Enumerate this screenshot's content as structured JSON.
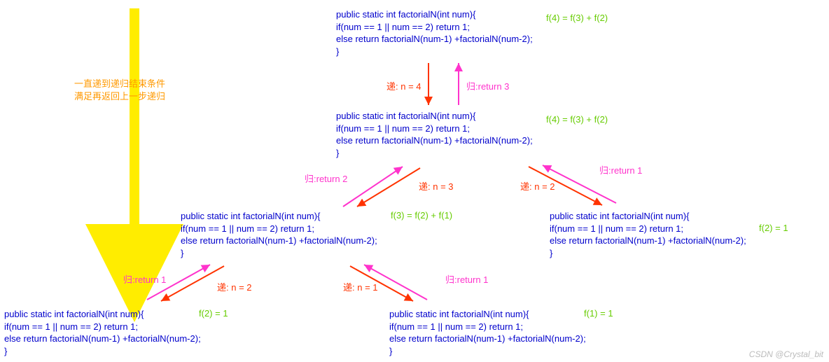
{
  "code": {
    "signature": "public static int factorialN(int num){",
    "line_if": "    if(num == 1 || num == 2) return 1;",
    "line_else": "    else return factorialN(num-1) +factorialN(num-2);",
    "close": "}"
  },
  "notes": {
    "n4": "f(4) = f(3) + f(2)",
    "n4b": "f(4) = f(3) + f(2)",
    "n3": "f(3) = f(2) + f(1)",
    "n2_eq": "f(2) =  1",
    "n2_eq_b": "f(2) =  1",
    "n1_eq": "f(1) = 1"
  },
  "comments": {
    "explain1": "一直递到递归结束条件",
    "explain2": "满足再返回上一步递归"
  },
  "arrows": {
    "down_n4": "递: n = 4",
    "down_n3": "递: n = 3",
    "down_n2": "递: n = 2",
    "down_n2b": "递: n = 2",
    "down_n1": "递: n = 1",
    "up_ret3": "归:return  3",
    "up_ret2": "归:return  2",
    "up_ret1a": "归:return 1",
    "up_ret1b": "归:return 1",
    "up_ret1c": "归:return  1"
  },
  "watermark": "CSDN @Crystal_bit"
}
